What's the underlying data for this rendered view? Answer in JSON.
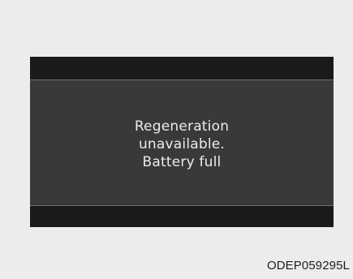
{
  "display": {
    "message_lines": [
      "Regeneration",
      "unavailable.",
      "Battery full"
    ]
  },
  "figure": {
    "code": "ODEP059295L"
  },
  "colors": {
    "page_background": "#ececec",
    "screen_bar": "#1a1a1a",
    "screen_content": "#393939",
    "message_text": "#ececec"
  }
}
